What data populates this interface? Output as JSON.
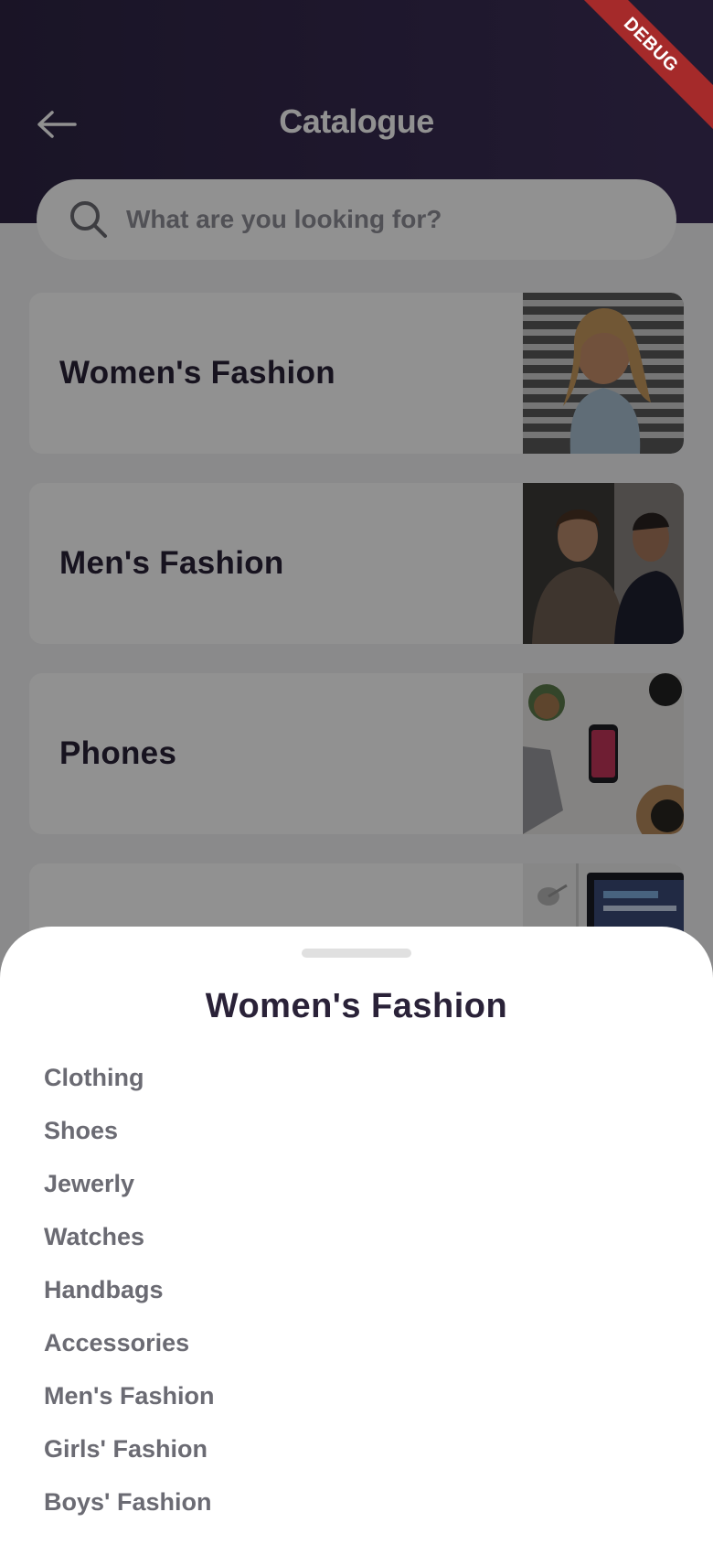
{
  "header": {
    "title": "Catalogue",
    "debug_label": "DEBUG"
  },
  "search": {
    "placeholder": "What are you looking for?"
  },
  "categories": [
    {
      "label": "Women's Fashion",
      "image": "woman-turtleneck-photo"
    },
    {
      "label": "Men's Fashion",
      "image": "two-men-photo"
    },
    {
      "label": "Phones",
      "image": "phone-desk-photo"
    },
    {
      "label": "",
      "image": "computer-desk-photo"
    }
  ],
  "sheet": {
    "title": "Women's Fashion",
    "items": [
      "Clothing",
      "Shoes",
      "Jewerly",
      "Watches",
      "Handbags",
      "Accessories",
      "Men's Fashion",
      "Girls' Fashion",
      "Boys' Fashion"
    ]
  },
  "colors": {
    "header_gradient_start": "#2e2444",
    "header_gradient_end": "#3d2f59",
    "debug_ribbon": "#a52a2a",
    "title_text": "#2a2238"
  }
}
